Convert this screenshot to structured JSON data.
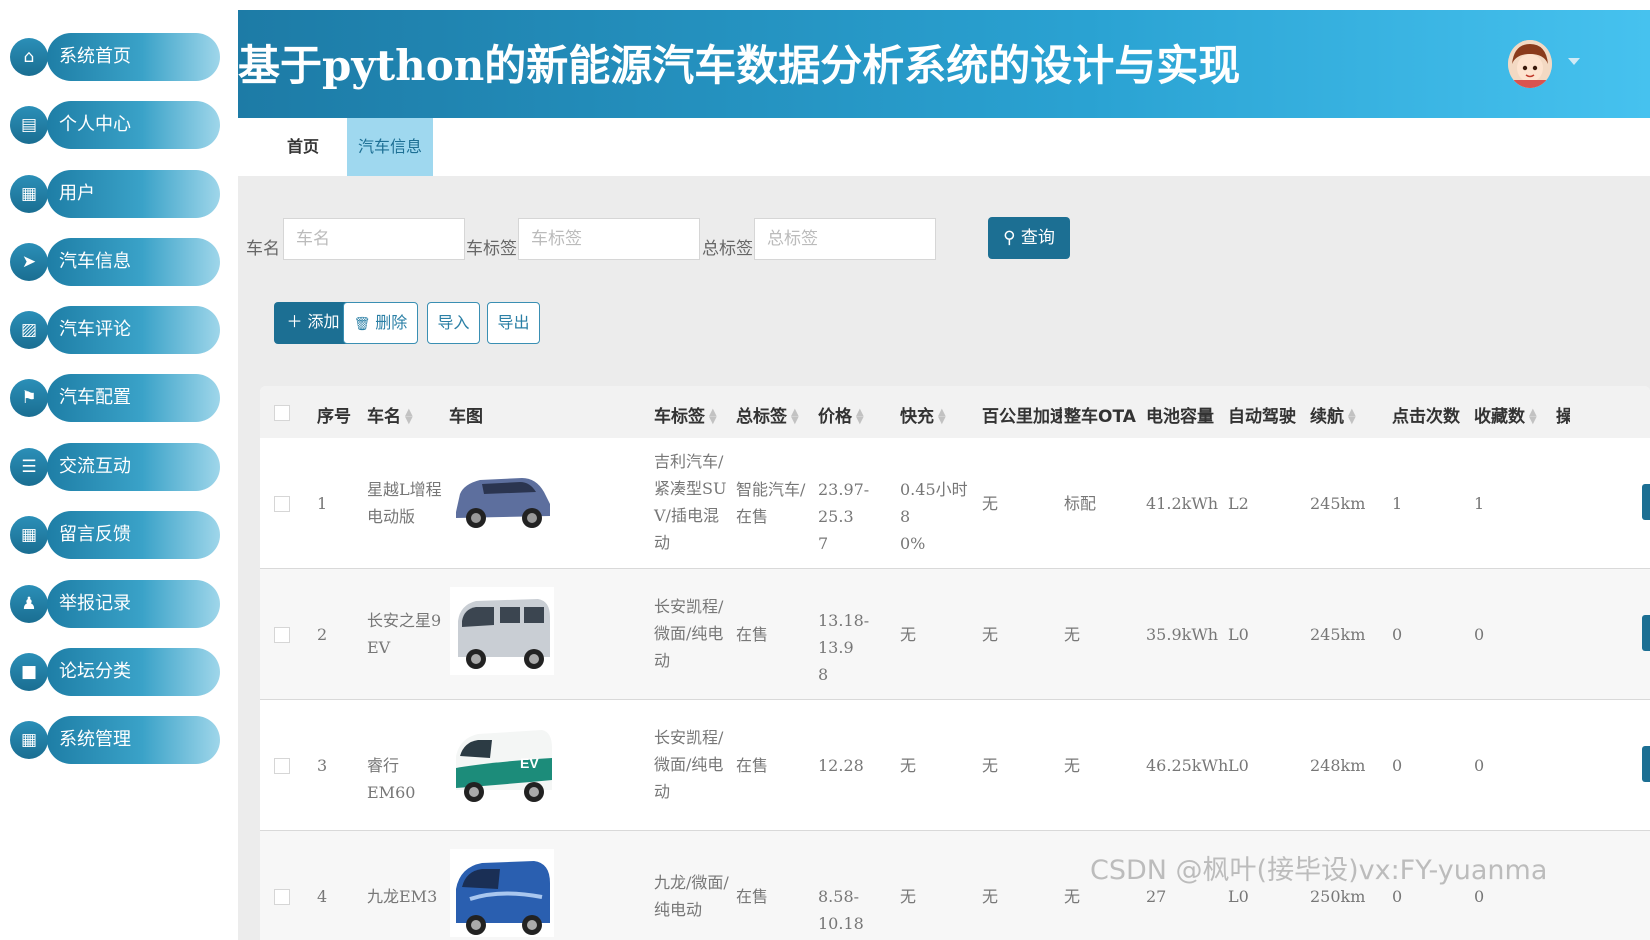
{
  "app": {
    "title": "基于python的新能源汽车数据分析系统的设计与实现"
  },
  "sidebar": {
    "items": [
      {
        "label": "系统首页",
        "icon": "home-icon",
        "glyph": "⌂"
      },
      {
        "label": "个人中心",
        "icon": "card-icon",
        "glyph": "▤"
      },
      {
        "label": "用户",
        "icon": "clipboard-icon",
        "glyph": "▦"
      },
      {
        "label": "汽车信息",
        "icon": "send-icon",
        "glyph": "➤"
      },
      {
        "label": "汽车评论",
        "icon": "chart-icon",
        "glyph": "▨"
      },
      {
        "label": "汽车配置",
        "icon": "flag-icon",
        "glyph": "⚑"
      },
      {
        "label": "交流互动",
        "icon": "list-icon",
        "glyph": "☰"
      },
      {
        "label": "留言反馈",
        "icon": "grid-icon",
        "glyph": "▦"
      },
      {
        "label": "举报记录",
        "icon": "user-icon",
        "glyph": "♟"
      },
      {
        "label": "论坛分类",
        "icon": "chat-icon",
        "glyph": "■"
      },
      {
        "label": "系统管理",
        "icon": "grid-icon",
        "glyph": "▦"
      }
    ]
  },
  "tabs": [
    {
      "label": "首页"
    },
    {
      "label": "汽车信息"
    }
  ],
  "search": {
    "name_label": "车名",
    "name_placeholder": "车名",
    "tag_label": "车标签",
    "tag_placeholder": "车标签",
    "total_label": "总标签",
    "total_placeholder": "总标签",
    "query_label": "查询"
  },
  "actions": {
    "add": "添加",
    "delete": "删除",
    "import": "导入",
    "export": "导出"
  },
  "table": {
    "headers": [
      "序号",
      "车名",
      "车图",
      "车标签",
      "总标签",
      "价格",
      "快充",
      "百公里加速",
      "整车OTA",
      "电池容量",
      "自动驾驶",
      "续航",
      "点击次数",
      "收藏数",
      "操"
    ],
    "rows": [
      {
        "no": "1",
        "name": [
          "星越L增程",
          "电动版"
        ],
        "tag": [
          "吉利汽车/",
          "紧凑型SU",
          "V/插电混",
          "动"
        ],
        "total": [
          "智能汽车/",
          "在售"
        ],
        "price": [
          "23.97-25.3",
          "7"
        ],
        "fast": [
          "0.45小时 8",
          "0%"
        ],
        "accel": "无",
        "ota": "标配",
        "battery": "41.2kWh",
        "auto": "L2",
        "range": "245km",
        "clicks": "1",
        "favs": "1"
      },
      {
        "no": "2",
        "name": [
          "长安之星9",
          "EV"
        ],
        "tag": [
          "长安凯程/",
          "微面/纯电",
          "动"
        ],
        "total": [
          "在售"
        ],
        "price": [
          "13.18-13.9",
          "8"
        ],
        "fast": [
          "无"
        ],
        "accel": "无",
        "ota": "无",
        "battery": "35.9kWh",
        "auto": "L0",
        "range": "245km",
        "clicks": "0",
        "favs": "0"
      },
      {
        "no": "3",
        "name": [
          "睿行EM60"
        ],
        "tag": [
          "长安凯程/",
          "微面/纯电",
          "动"
        ],
        "total": [
          "在售"
        ],
        "price": [
          "12.28"
        ],
        "fast": [
          "无"
        ],
        "accel": "无",
        "ota": "无",
        "battery": "46.25kWh",
        "auto": "L0",
        "range": "248km",
        "clicks": "0",
        "favs": "0"
      },
      {
        "no": "4",
        "name": [
          "九龙EM3"
        ],
        "tag": [
          "九龙/微面/",
          "纯电动"
        ],
        "total": [
          "在售"
        ],
        "price": [
          "8.58-10.18"
        ],
        "fast": [
          "无"
        ],
        "accel": "无",
        "ota": "无",
        "battery": "27",
        "auto": "L0",
        "range": "250km",
        "clicks": "0",
        "favs": "0"
      }
    ]
  },
  "watermark": "CSDN @枫叶(接毕设)vx:FY-yuanma",
  "colors": {
    "primary": "#1c6f93",
    "header_start": "#1d7ba6",
    "header_end": "#46c2ef",
    "tab_active": "#9fd8ef"
  }
}
